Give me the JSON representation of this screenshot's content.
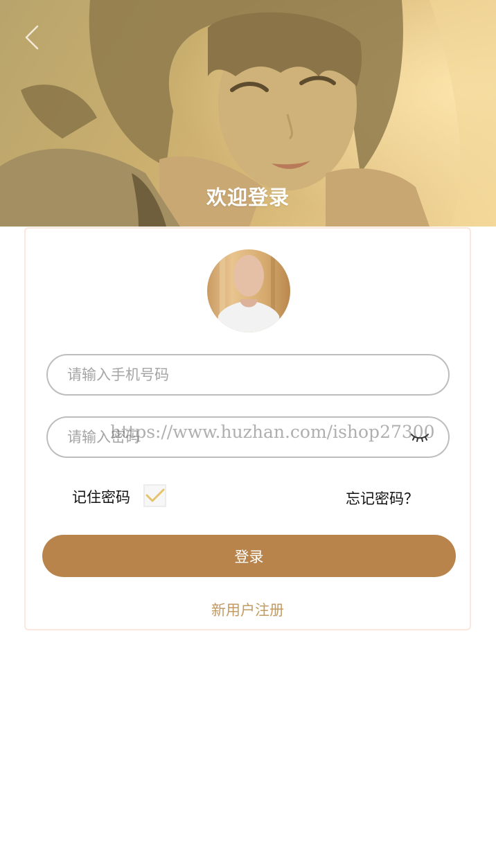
{
  "header": {
    "title": "欢迎登录",
    "back_icon": "chevron-left-icon"
  },
  "form": {
    "phone_placeholder": "请输入手机号码",
    "password_placeholder": "请输入密码",
    "watermark": "https://www.huzhan.com/ishop27300",
    "eye_icon": "eye-closed-icon",
    "remember_label": "记住密码",
    "remember_checked": true,
    "forgot_label": "忘记密码？",
    "login_label": "登录",
    "register_label": "新用户注册"
  },
  "colors": {
    "accent": "#b8844b",
    "link": "#c39a62",
    "check": "#e6c26a"
  }
}
